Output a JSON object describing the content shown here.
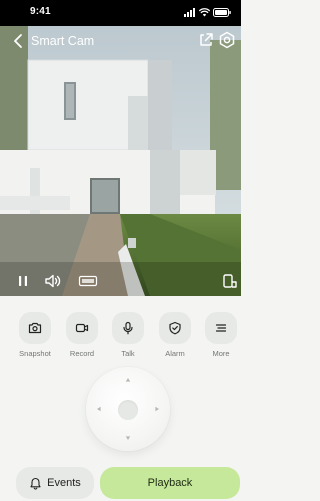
{
  "status_bar": {
    "time": "9:41",
    "icons": [
      "signal-icon",
      "wifi-icon",
      "battery-icon"
    ]
  },
  "header": {
    "back_icon": "chevron-left-icon",
    "title": "Smart Cam",
    "share_icon": "share-icon",
    "settings_icon": "settings-icon"
  },
  "video_controls": {
    "pause_icon": "pause-icon",
    "volume_icon": "speaker-icon",
    "quality_badge_icon": "hd-icon",
    "orientation_icon": "rotate-icon"
  },
  "actions": [
    {
      "label": "Snapshot",
      "icon": "camera-icon"
    },
    {
      "label": "Record",
      "icon": "video-icon"
    },
    {
      "label": "Talk",
      "icon": "microphone-icon"
    },
    {
      "label": "Alarm",
      "icon": "shield-check-icon"
    },
    {
      "label": "More",
      "icon": "menu-icon"
    }
  ],
  "ptz": {
    "center_icon": "ptz-center",
    "arrows": [
      "up",
      "down",
      "left",
      "right"
    ]
  },
  "bottom": {
    "events_label": "Events",
    "events_icon": "bell-icon",
    "playback_label": "Playback"
  },
  "colors": {
    "accent": "#c6e89b",
    "button_bg": "#e7e9e6",
    "background": "#f4f5f3"
  }
}
